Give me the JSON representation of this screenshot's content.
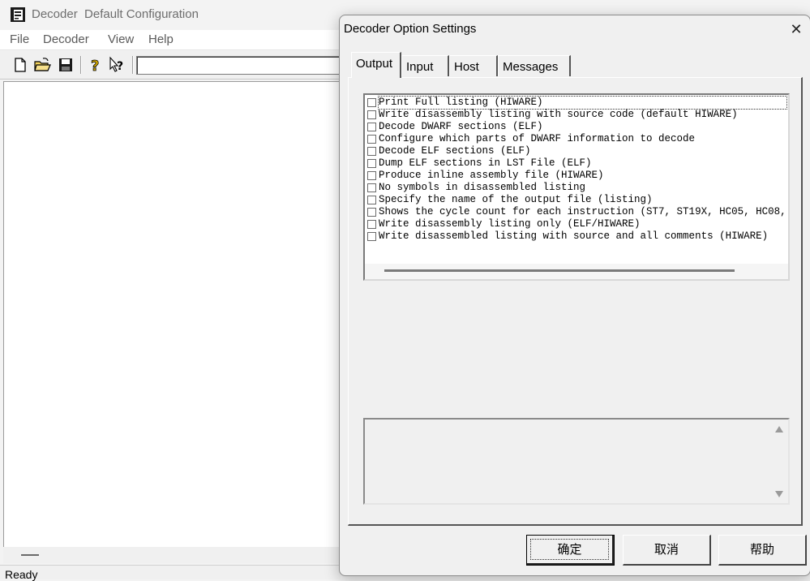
{
  "main_window": {
    "title": "Decoder  Default Configuration",
    "menu": [
      "File",
      "Decoder",
      "View",
      "Help"
    ],
    "toolbar": {
      "buttons": [
        "new-file-icon",
        "open-folder-icon",
        "save-icon",
        "help-icon",
        "context-help-icon"
      ],
      "combo_value": ""
    },
    "status": "Ready"
  },
  "dialog": {
    "title": "Decoder Option Settings",
    "close_glyph": "✕",
    "tabs": [
      {
        "label": "Output",
        "active": true
      },
      {
        "label": "Input",
        "active": false
      },
      {
        "label": "Host",
        "active": false
      },
      {
        "label": "Messages",
        "active": false
      }
    ],
    "options": [
      {
        "label": "Print Full listing (HIWARE)",
        "checked": false
      },
      {
        "label": "Write disassembly listing with source code (default HIWARE)",
        "checked": false
      },
      {
        "label": "Decode DWARF sections (ELF)",
        "checked": false
      },
      {
        "label": "Configure which parts of DWARF information to decode",
        "checked": false
      },
      {
        "label": "Decode ELF sections (ELF)",
        "checked": false
      },
      {
        "label": "Dump ELF sections in LST File (ELF)",
        "checked": false
      },
      {
        "label": "Produce inline assembly file (HIWARE)",
        "checked": false
      },
      {
        "label": "No symbols in disassembled listing",
        "checked": false
      },
      {
        "label": "Specify the name of the output file (listing)",
        "checked": false
      },
      {
        "label": "Shows the cycle count for each instruction (ST7, ST19X, HC05, HC08,",
        "checked": false
      },
      {
        "label": "Write disassembly listing only (ELF/HIWARE)",
        "checked": false
      },
      {
        "label": "Write disassembled listing with source and all comments (HIWARE)",
        "checked": false
      }
    ],
    "description": "",
    "buttons": {
      "ok": "确定",
      "cancel": "取消",
      "help": "帮助"
    }
  }
}
